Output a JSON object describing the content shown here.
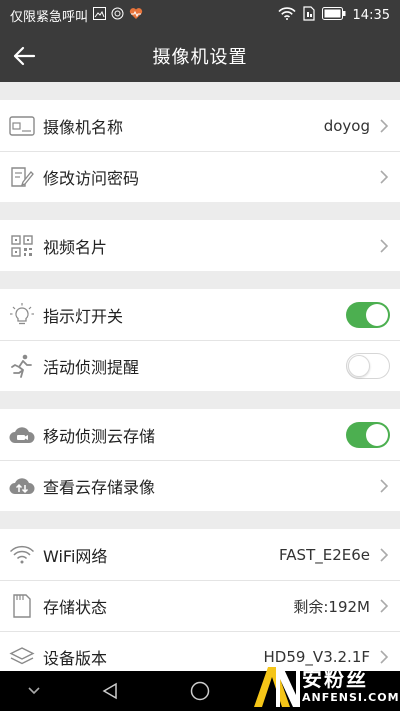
{
  "status_bar": {
    "carrier_text": "仅限紧急呼叫",
    "time": "14:35"
  },
  "header": {
    "title": "摄像机设置"
  },
  "sections": [
    {
      "rows": [
        {
          "label": "摄像机名称",
          "value": "doyog",
          "icon": "id-card-icon"
        },
        {
          "label": "修改访问密码",
          "icon": "edit-document-icon"
        }
      ]
    },
    {
      "rows": [
        {
          "label": "视频名片",
          "icon": "qr-code-icon"
        }
      ]
    },
    {
      "rows": [
        {
          "label": "指示灯开关",
          "icon": "lightbulb-icon",
          "toggle": "on"
        },
        {
          "label": "活动侦测提醒",
          "icon": "running-person-icon",
          "toggle": "off"
        }
      ]
    },
    {
      "rows": [
        {
          "label": "移动侦测云存储",
          "icon": "cloud-icon",
          "toggle": "on"
        },
        {
          "label": "查看云存储录像",
          "icon": "cloud-sync-icon"
        }
      ]
    },
    {
      "rows": [
        {
          "label": "WiFi网络",
          "value": "FAST_E2E6e",
          "icon": "wifi-icon"
        },
        {
          "label": "存储状态",
          "value": "剩余:192M",
          "icon": "sd-card-icon"
        },
        {
          "label": "设备版本",
          "value": "HD59_V3.2.1F",
          "icon": "layers-icon"
        }
      ]
    }
  ],
  "watermark": {
    "logo_text": "AN",
    "cn_text": "安粉丝",
    "en_text": "ANFENSI.COM"
  },
  "colors": {
    "bar": "#3b3b3b",
    "toggle_on": "#4caf50",
    "background": "#ececec",
    "watermark_accent": "#f5c518"
  }
}
